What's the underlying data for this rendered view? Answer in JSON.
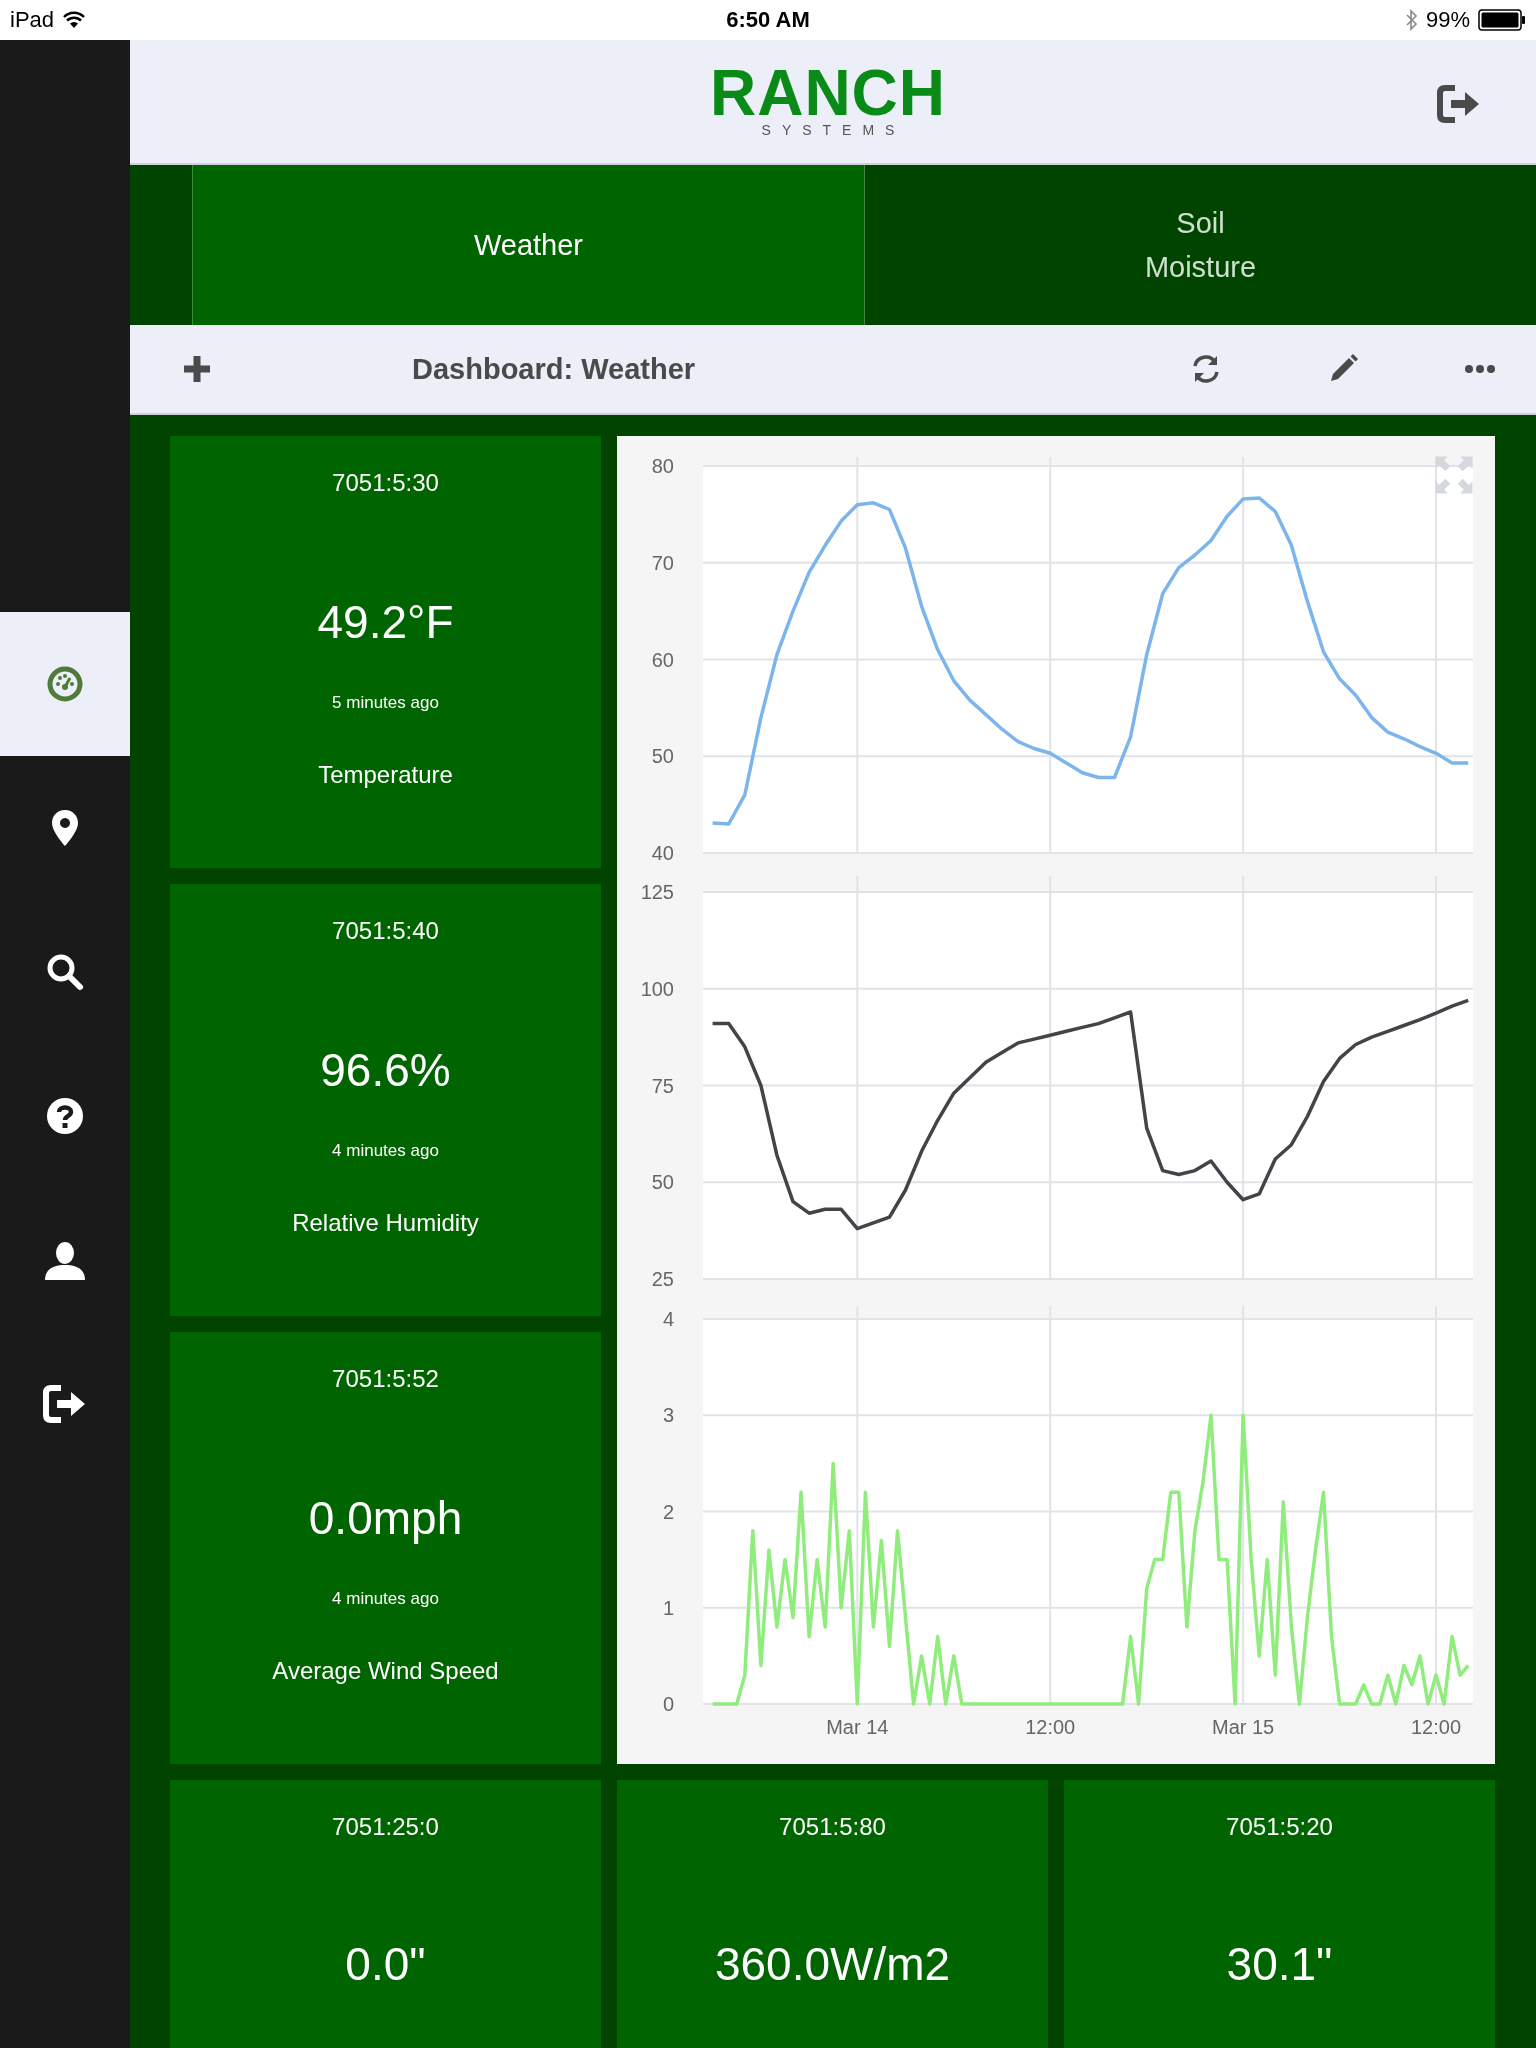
{
  "status_bar": {
    "device": "iPad",
    "time": "6:50 AM",
    "battery": "99%"
  },
  "sidebar": {
    "items": [
      {
        "kind": "dashboard",
        "selected": true
      },
      {
        "kind": "pin",
        "selected": false
      },
      {
        "kind": "search",
        "selected": false
      },
      {
        "kind": "help",
        "selected": false
      },
      {
        "kind": "user",
        "selected": false
      },
      {
        "kind": "logout",
        "selected": false
      }
    ]
  },
  "header": {
    "logo": {
      "name": "RANCH",
      "tagline": "SYSTEMS"
    }
  },
  "tabs": [
    {
      "label": "Weather",
      "selected": true
    },
    {
      "label": "Soil Moisture",
      "selected": false
    }
  ],
  "toolbar": {
    "title": "Dashboard: Weather"
  },
  "tiles": [
    {
      "id": "7051:5:30",
      "value": "49.2°F",
      "updated": "5 minutes ago",
      "label": "Temperature"
    },
    {
      "id": "7051:5:40",
      "value": "96.6%",
      "updated": "4 minutes ago",
      "label": "Relative Humidity"
    },
    {
      "id": "7051:5:52",
      "value": "0.0mph",
      "updated": "4 minutes ago",
      "label": "Average Wind Speed"
    }
  ],
  "chart_panel": {
    "charts": [
      {
        "chart_data": {
          "type": "line",
          "grid": true,
          "ylim": [
            40,
            80
          ],
          "yticks": [
            40,
            50,
            60,
            70,
            80
          ],
          "series": [
            {
              "color": "#7cb5ec",
              "values": [
                43.1,
                43,
                46,
                54,
                60.5,
                65,
                69,
                71.8,
                74.3,
                76,
                76.2,
                75.5,
                71.5,
                65.5,
                61,
                57.8,
                55.8,
                54.3,
                52.8,
                51.5,
                50.8,
                50.3,
                49.3,
                48.3,
                47.8,
                47.8,
                52,
                60.5,
                66.8,
                69.5,
                70.8,
                72.3,
                74.8,
                76.6,
                76.7,
                75.3,
                71.8,
                66,
                60.8,
                58,
                56.3,
                54,
                52.5,
                51.8,
                51,
                50.3,
                49.3,
                49.3
              ]
            }
          ]
        }
      },
      {
        "chart_data": {
          "type": "line",
          "grid": true,
          "ylim": [
            25,
            125
          ],
          "yticks": [
            25,
            50,
            75,
            100,
            125
          ],
          "series": [
            {
              "color": "#434348",
              "values": [
                91,
                91,
                85,
                75,
                57,
                45,
                42,
                43,
                43,
                38,
                39.5,
                41,
                48,
                58,
                66,
                73,
                77,
                81,
                83.5,
                86,
                87,
                88,
                89,
                90,
                91,
                92.5,
                94,
                64,
                53,
                52,
                53,
                55.5,
                50,
                45.5,
                47,
                56,
                59.7,
                67,
                76,
                82,
                85.6,
                87.5,
                89,
                90.5,
                92,
                93.7,
                95.5,
                97
              ]
            }
          ]
        }
      },
      {
        "chart_data": {
          "type": "line",
          "grid": true,
          "ylim": [
            0,
            4
          ],
          "yticks": [
            0,
            1,
            2,
            3,
            4
          ],
          "categories": [
            null,
            null,
            null,
            null,
            null,
            null,
            null,
            null,
            null,
            null,
            null,
            null,
            null,
            null,
            null,
            null,
            null,
            null,
            "Mar 14",
            null,
            null,
            null,
            null,
            null,
            null,
            null,
            null,
            null,
            null,
            null,
            null,
            null,
            null,
            null,
            null,
            null,
            null,
            null,
            null,
            null,
            null,
            null,
            "12:00",
            null,
            null,
            null,
            null,
            null,
            null,
            null,
            null,
            null,
            null,
            null,
            null,
            null,
            null,
            null,
            null,
            null,
            null,
            null,
            null,
            null,
            null,
            null,
            "Mar 15",
            null,
            null,
            null,
            null,
            null,
            null,
            null,
            null,
            null,
            null,
            null,
            null,
            null,
            null,
            null,
            null,
            null,
            null,
            null,
            null,
            null,
            null,
            null,
            "12:00",
            null,
            null,
            null,
            null
          ],
          "series": [
            {
              "color": "#90ed7d",
              "values": [
                0,
                0,
                0,
                0,
                0.3,
                1.8,
                0.4,
                1.6,
                0.8,
                1.5,
                0.9,
                2.2,
                0.7,
                1.5,
                0.8,
                2.5,
                1,
                1.8,
                0,
                2.2,
                0.8,
                1.7,
                0.6,
                1.8,
                0.9,
                0,
                0.5,
                0,
                0.7,
                0,
                0.5,
                0,
                0,
                0,
                0,
                0,
                0,
                0,
                0,
                0,
                0,
                0,
                0,
                0,
                0,
                0,
                0,
                0,
                0,
                0,
                0,
                0,
                0.7,
                0,
                1.2,
                1.5,
                1.5,
                2.2,
                2.2,
                0.8,
                1.8,
                2.3,
                3,
                1.5,
                1.5,
                0,
                3,
                1.5,
                0.5,
                1.5,
                0.3,
                2.1,
                0.8,
                0,
                0.9,
                1.6,
                2.2,
                0.7,
                0,
                0,
                0,
                0.2,
                0,
                0,
                0.3,
                0,
                0.4,
                0.2,
                0.5,
                0,
                0.3,
                0,
                0.7,
                0.3,
                0.4
              ]
            }
          ]
        }
      }
    ]
  },
  "bottom_tiles": [
    {
      "id": "7051:25:0",
      "value": "0.0\""
    },
    {
      "id": "7051:5:80",
      "value": "360.0W/m2"
    },
    {
      "id": "7051:5:20",
      "value": "30.1\""
    }
  ]
}
